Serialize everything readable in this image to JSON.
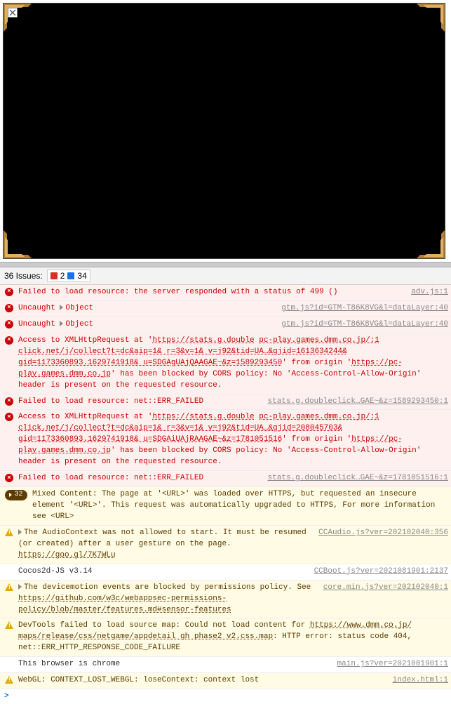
{
  "game": {
    "broken_image_alt": "broken-image"
  },
  "issues_bar": {
    "label": "36 Issues:",
    "error_count": "2",
    "info_count": "34"
  },
  "rows": [
    {
      "type": "error",
      "icon": "error-circle",
      "msg_html": "Failed to load resource: the server responded with a status of 499 ()",
      "src": "adv.js:1"
    },
    {
      "type": "error",
      "icon": "error-circle",
      "msg_html": "Uncaught  <span class='expand-caret'></span>Object",
      "src": "gtm.js?id=GTM-T86K8VG&l=dataLayer:40"
    },
    {
      "type": "error",
      "icon": "error-circle",
      "msg_html": "Uncaught  <span class='expand-caret'></span>Object",
      "src": "gtm.js?id=GTM-T86K8VG&l=dataLayer:40"
    },
    {
      "type": "error",
      "icon": "error-circle",
      "msg_html": "Access to XMLHttpRequest at '<span class='u'>https://stats.g.double</span> <span class='u'>pc-play.games.dmm.co.jp/:1</span> <span class='u'>click.net/j/collect?t=dc&aip=1& r=3&v=1& v=j92&tid=UA…&gjid=1613634244& gid=1173360893.1629741918& u=SDGAgUAjQAAGAE~&z=1589293450</span>' from origin '<span class='u'>https://pc-play.games.dmm.co.jp</span>' has been blocked by CORS policy: No 'Access-Control-Allow-Origin' header is present on the requested resource.",
      "src": ""
    },
    {
      "type": "error",
      "icon": "error-circle",
      "msg_html": "Failed to load resource: net::ERR_FAILED",
      "src": "stats.g.doubleclick…GAE~&z=1589293450:1"
    },
    {
      "type": "error",
      "icon": "error-circle",
      "msg_html": "Access to XMLHttpRequest at '<span class='u'>https://stats.g.double</span> <span class='u'>pc-play.games.dmm.co.jp/:1</span> <span class='u'>click.net/j/collect?t=dc&aip=1& r=3&v=1& v=j92&tid=UA…&gjid=208045703& gid=1173360893.1629741918& u=SDGAiUAjRAAGAE~&z=1781051516</span>' from origin '<span class='u'>https://pc-play.games.dmm.co.jp</span>' has been blocked by CORS policy: No 'Access-Control-Allow-Origin' header is present on the requested resource.",
      "src": ""
    },
    {
      "type": "error",
      "icon": "error-circle",
      "msg_html": "Failed to load resource: net::ERR_FAILED",
      "src": "stats.g.doubleclick…GAE~&z=1781051516:1"
    },
    {
      "type": "warn",
      "icon": "badge-32",
      "msg_html": "Mixed Content: The page at '&lt;URL&gt;' was loaded over HTTPS, but requested an insecure element '&lt;URL&gt;'. This request was automatically upgraded to HTTPS, For more information see &lt;URL&gt;",
      "src": ""
    },
    {
      "type": "warn",
      "icon": "warn-tri",
      "msg_html": "<span class='expand-caret'></span>The AudioContext was not allowed to start. It must be resumed (or created) after a user gesture on the page. <span class='u'>https://goo.gl/7K7WLu</span>",
      "src": "CCAudio.js?ver=202102040:356"
    },
    {
      "type": "info",
      "icon": "",
      "msg_html": "Cocos2d-JS v3.14",
      "src": "CCBoot.js?ver=2021081901:2137"
    },
    {
      "type": "warn",
      "icon": "warn-tri",
      "msg_html": "<span class='expand-caret'></span>The devicemotion events are blocked by permissions policy. See <span class='u'>https://github.com/w3c/webappsec-permissions-policy/blob/master/features.md#sensor-features</span>",
      "src": "core.min.js?ver=202102040:1"
    },
    {
      "type": "warn",
      "icon": "warn-tri",
      "msg_html": "DevTools failed to load source map: Could not load content for <span class='u'>https://www.dmm.co.jp/ maps/release/css/netgame/appdetail gh phase2 v2.css.map</span>: HTTP error: status code 404, net::ERR_HTTP_RESPONSE_CODE_FAILURE",
      "src": ""
    },
    {
      "type": "info",
      "icon": "",
      "msg_html": "This browser is chrome",
      "src": "main.js?ver=2021081901:1"
    },
    {
      "type": "warn",
      "icon": "warn-tri",
      "msg_html": "WebGL: CONTEXT_LOST_WEBGL: loseContext: context lost",
      "src": "index.html:1"
    }
  ],
  "prompt": ">"
}
